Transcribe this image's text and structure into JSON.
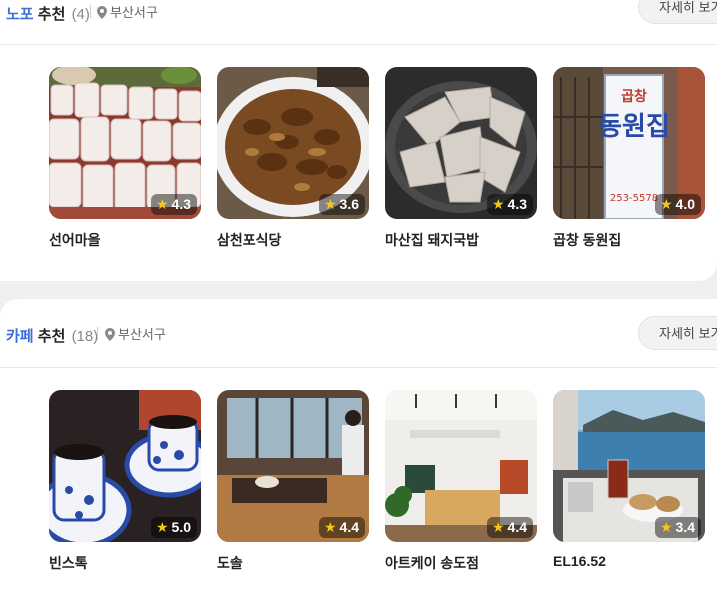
{
  "sections": [
    {
      "category": "노포",
      "recommend": "추천",
      "count": "(4)",
      "location": "부산서구",
      "more_label": "자세히 보기",
      "places": [
        {
          "name": "선어마을",
          "rating": "4.3",
          "photo": "sliced-raw-fish"
        },
        {
          "name": "삼천포식당",
          "rating": "3.6",
          "photo": "stir-fried-pork"
        },
        {
          "name": "마산집 돼지국밥",
          "rating": "4.3",
          "photo": "boiled-pork-slices"
        },
        {
          "name": "곱창 동원집",
          "rating": "4.0",
          "photo": "restaurant-signboard"
        }
      ]
    },
    {
      "category": "카페",
      "recommend": "추천",
      "count": "(18)",
      "location": "부산서구",
      "more_label": "자세히 보기",
      "places": [
        {
          "name": "빈스톡",
          "rating": "5.0",
          "photo": "coffee-cups"
        },
        {
          "name": "도솔",
          "rating": "4.4",
          "photo": "cafe-window-view"
        },
        {
          "name": "아트케이 송도점",
          "rating": "4.4",
          "photo": "gallery-cafe-interior"
        },
        {
          "name": "EL16.52",
          "rating": "3.4",
          "photo": "ocean-view-table"
        }
      ]
    }
  ],
  "signboard": {
    "text1": "곱창",
    "text2": "동원집",
    "phone": "253-5578"
  },
  "colors": {
    "accent": "#3d6fd9",
    "star": "#f5c518"
  }
}
